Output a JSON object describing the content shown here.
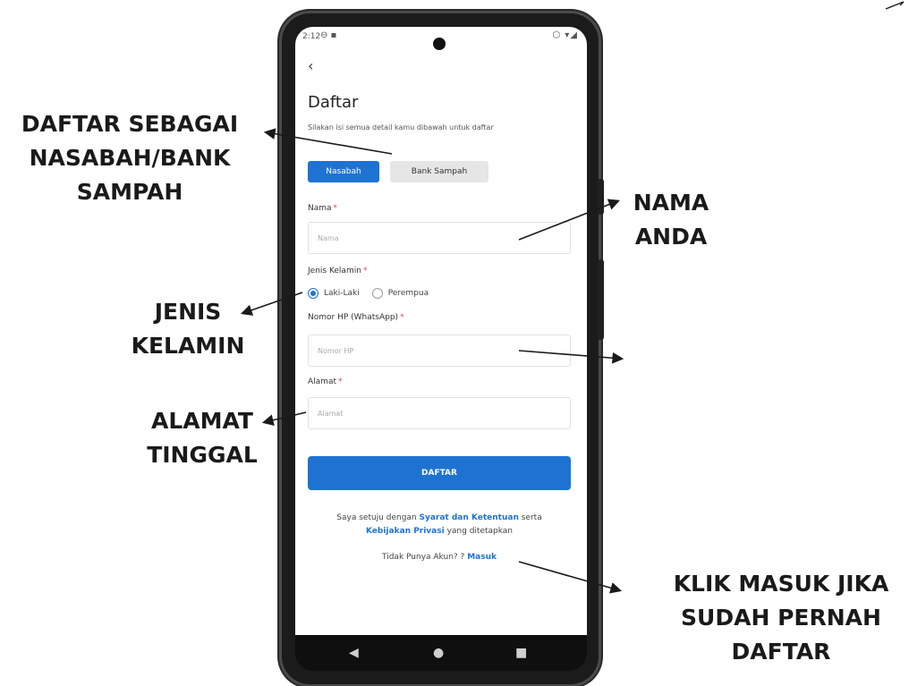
{
  "status": {
    "time": "2:12",
    "sys_icons": "⊖ ▪",
    "right_icons": "⬡ ▾◢"
  },
  "header": {
    "back": "‹",
    "title": "Daftar",
    "subtitle": "Silakan isi semua detail kamu dibawah untuk daftar"
  },
  "tabs": [
    {
      "label": "Nasabah",
      "active": true
    },
    {
      "label": "Bank Sampah",
      "active": false
    }
  ],
  "form": {
    "nama": {
      "label": "Nama",
      "required": "*",
      "placeholder": "Nama"
    },
    "gender": {
      "label": "Jenis Kelamin",
      "required": "*",
      "options": [
        {
          "label": "Laki-Laki",
          "checked": true
        },
        {
          "label": "Perempua",
          "checked": false
        }
      ]
    },
    "phone": {
      "label": "Nomor HP (WhatsApp)",
      "required": "*",
      "placeholder": "Nomor HP"
    },
    "alamat": {
      "label": "Alamat",
      "required": "*",
      "placeholder": "Alamat"
    },
    "submit": "DAFTAR"
  },
  "terms": {
    "prefix": "Saya setuju dengan",
    "link1": "Syarat dan Ketentuan",
    "mid": "serta",
    "link2": "Kebijakan Privasi",
    "suffix": "yang ditetapkan"
  },
  "login": {
    "prefix": "Tidak Punya Akun? ?",
    "link": "Masuk"
  },
  "navbar": {
    "back": "◀",
    "home": "●",
    "recent": "■"
  },
  "annotations": {
    "daftar": [
      "DAFTAR SEBAGAI",
      "NASABAH/BANK",
      "SAMPAH"
    ],
    "nama": [
      "NAMA",
      "ANDA"
    ],
    "jenis": [
      "JENIS",
      "KELAMIN"
    ],
    "alamat": [
      "ALAMAT",
      "TINGGAL"
    ],
    "klik": [
      "KLIK MASUK JIKA",
      "SUDAH PERNAH",
      "DAFTAR"
    ]
  },
  "colors": {
    "accent": "#1e73d2",
    "required": "#e04848"
  }
}
